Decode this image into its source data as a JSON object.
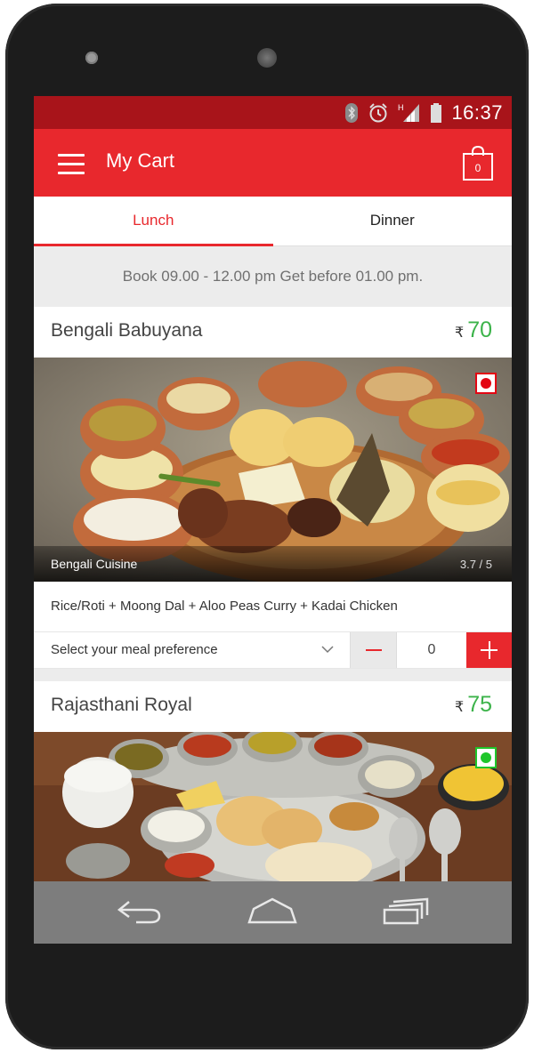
{
  "status_bar": {
    "time": "16:37",
    "icons": [
      "bluetooth-icon",
      "alarm-icon",
      "signal-icon",
      "battery-icon"
    ],
    "network_label": "H"
  },
  "app_bar": {
    "title": "My Cart",
    "cart_count": "0"
  },
  "tabs": [
    {
      "label": "Lunch",
      "active": true
    },
    {
      "label": "Dinner",
      "active": false
    }
  ],
  "booking_info": "Book 09.00 - 12.00 pm Get before 01.00 pm.",
  "meals": [
    {
      "name": "Bengali Babuyana",
      "currency": "₹",
      "price": "70",
      "cuisine": "Bengali Cuisine",
      "rating": "3.7 / 5",
      "veg": false,
      "description": "Rice/Roti + Moong Dal + Aloo Peas Curry + Kadai Chicken",
      "preference_placeholder": "Select your meal preference",
      "quantity": "0"
    },
    {
      "name": "Rajasthani Royal",
      "currency": "₹",
      "price": "75",
      "veg": true
    }
  ],
  "colors": {
    "primary": "#e8282d",
    "status_bar": "#a8141a",
    "price": "#3cb34a",
    "non_veg": "#e30613",
    "veg": "#1fc62b"
  },
  "nav_bar": {
    "icons": [
      "back-icon",
      "home-icon",
      "recent-apps-icon"
    ]
  }
}
